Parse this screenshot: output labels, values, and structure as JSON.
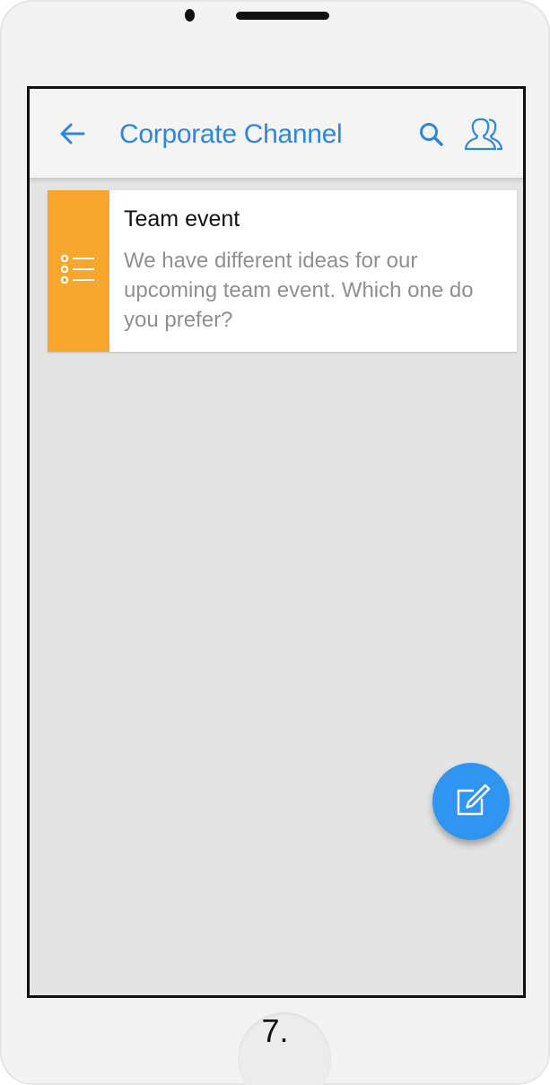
{
  "header": {
    "title": "Corporate Channel",
    "back_icon": "arrow-left-icon",
    "search_icon": "search-icon",
    "members_icon": "members-icon"
  },
  "channel": {
    "posts": [
      {
        "type_icon": "list-icon",
        "title": "Team event",
        "text": "We have different ideas for our upcoming team event. Which one do you prefer?"
      }
    ]
  },
  "fab": {
    "icon": "compose-icon"
  },
  "caption": {
    "step": "7."
  },
  "colors": {
    "accent": "#2e86de",
    "fab": "#2f95f0",
    "post_strip": "#f8a72e",
    "background": "#e4e4e4"
  }
}
